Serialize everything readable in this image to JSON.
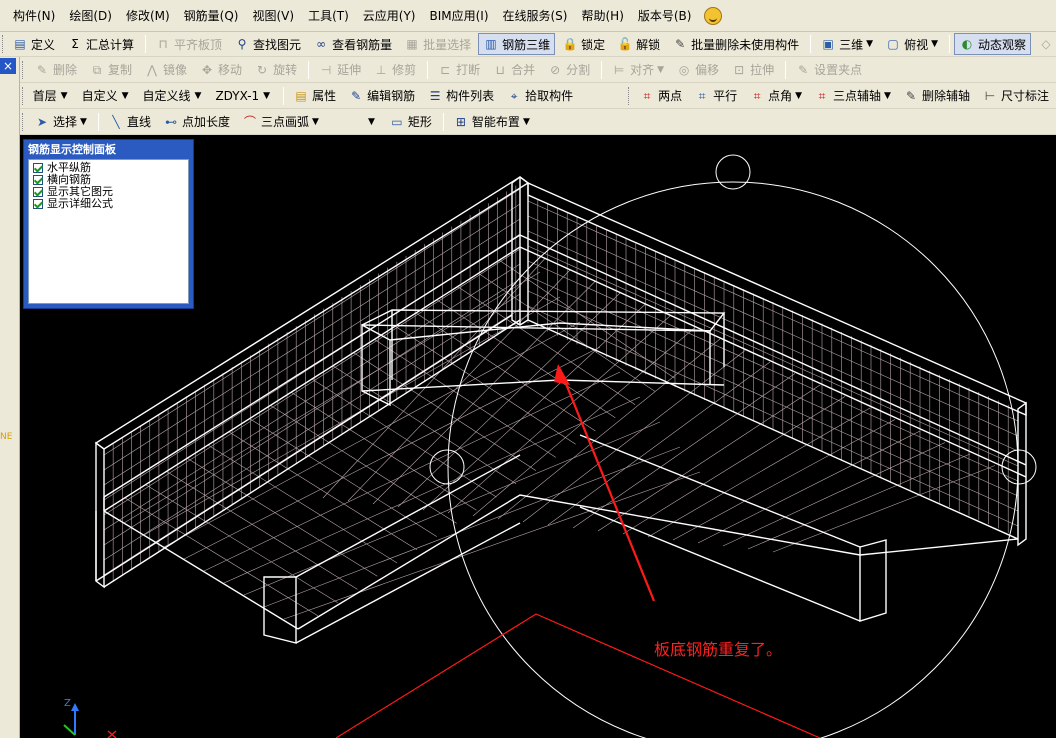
{
  "menu": {
    "items": [
      "构件(N)",
      "绘图(D)",
      "修改(M)",
      "钢筋量(Q)",
      "视图(V)",
      "工具(T)",
      "云应用(Y)",
      "BIM应用(I)",
      "在线服务(S)",
      "帮助(H)",
      "版本号(B)"
    ]
  },
  "toolbar1": {
    "items": [
      {
        "label": "定义",
        "icon": "define-icon",
        "glyph": "▤",
        "color": "#2a5ca8"
      },
      {
        "label": "汇总计算",
        "icon": "sigma-icon",
        "glyph": "Σ",
        "color": "#000000"
      },
      {
        "label": "平齐板顶",
        "icon": "align-top-icon",
        "glyph": "⊓",
        "color": "#a7a59a",
        "disabled": true
      },
      {
        "label": "查找图元",
        "icon": "binoculars-icon",
        "glyph": "⚲",
        "color": "#1b3f8a"
      },
      {
        "label": "查看钢筋量",
        "icon": "view-rebar-icon",
        "glyph": "∞",
        "color": "#1b3f8a"
      },
      {
        "label": "批量选择",
        "icon": "batch-select-icon",
        "glyph": "▦",
        "color": "#a7a59a",
        "disabled": true
      },
      {
        "label": "钢筋三维",
        "icon": "rebar-3d-icon",
        "glyph": "▥",
        "color": "#2a5ca8",
        "active": true
      },
      {
        "label": "锁定",
        "icon": "lock-icon",
        "glyph": "🔒",
        "color": "#c8951a"
      },
      {
        "label": "解锁",
        "icon": "unlock-icon",
        "glyph": "🔓",
        "color": "#c8951a"
      },
      {
        "label": "批量删除未使用构件",
        "icon": "batch-delete-icon",
        "glyph": "✎",
        "color": "#444444"
      },
      {
        "label": "三维",
        "icon": "cube-icon",
        "glyph": "▣",
        "color": "#2a5ca8",
        "dropdown": true
      },
      {
        "label": "俯视",
        "icon": "top-view-icon",
        "glyph": "▢",
        "color": "#2a5ca8",
        "dropdown": true
      },
      {
        "label": "动态观察",
        "icon": "orbit-icon",
        "glyph": "◐",
        "color": "#2f8a2f",
        "active": true
      },
      {
        "label": "局部三维",
        "icon": "partial-3d-icon",
        "glyph": "◇",
        "color": "#a7a59a",
        "disabled": true
      }
    ]
  },
  "toolbar2": {
    "items": [
      {
        "label": "删除",
        "icon": "delete-icon",
        "glyph": "✎"
      },
      {
        "label": "复制",
        "icon": "copy-icon",
        "glyph": "⧉"
      },
      {
        "label": "镜像",
        "icon": "mirror-icon",
        "glyph": "⋀"
      },
      {
        "label": "移动",
        "icon": "move-icon",
        "glyph": "✥"
      },
      {
        "label": "旋转",
        "icon": "rotate-icon",
        "glyph": "↻"
      },
      {
        "label": "延伸",
        "icon": "extend-icon",
        "glyph": "⊣"
      },
      {
        "label": "修剪",
        "icon": "trim-icon",
        "glyph": "⊥"
      },
      {
        "label": "打断",
        "icon": "break-icon",
        "glyph": "⊏"
      },
      {
        "label": "合并",
        "icon": "merge-icon",
        "glyph": "⊔"
      },
      {
        "label": "分割",
        "icon": "split-icon",
        "glyph": "⊘"
      },
      {
        "label": "对齐",
        "icon": "align-icon",
        "glyph": "⊨",
        "dropdown": true
      },
      {
        "label": "偏移",
        "icon": "offset-icon",
        "glyph": "◎"
      },
      {
        "label": "拉伸",
        "icon": "stretch-icon",
        "glyph": "⊡"
      },
      {
        "label": "设置夹点",
        "icon": "grip-point-icon",
        "glyph": "✎"
      }
    ]
  },
  "toolbar3": {
    "floor": "首层",
    "category": "自定义",
    "subtype": "自定义线",
    "component": "ZDYX-1",
    "buttons": [
      {
        "label": "属性",
        "icon": "properties-icon",
        "glyph": "▤",
        "color": "#c8951a"
      },
      {
        "label": "编辑钢筋",
        "icon": "edit-rebar-icon",
        "glyph": "✎",
        "color": "#1b3f8a"
      },
      {
        "label": "构件列表",
        "icon": "component-list-icon",
        "glyph": "☰",
        "color": "#1b3f8a"
      },
      {
        "label": "拾取构件",
        "icon": "pick-component-icon",
        "glyph": "⌖",
        "color": "#1b3f8a"
      }
    ],
    "right_buttons": [
      {
        "label": "两点",
        "icon": "two-point-icon",
        "glyph": "⌗",
        "color": "#c62020"
      },
      {
        "label": "平行",
        "icon": "parallel-icon",
        "glyph": "⌗",
        "color": "#2a5ca8"
      },
      {
        "label": "点角",
        "icon": "point-angle-icon",
        "glyph": "⌗",
        "color": "#c62020",
        "dropdown": true
      },
      {
        "label": "三点辅轴",
        "icon": "three-point-axis-icon",
        "glyph": "⌗",
        "color": "#c62020",
        "dropdown": true
      },
      {
        "label": "删除辅轴",
        "icon": "delete-axis-icon",
        "glyph": "✎",
        "color": "#444444"
      },
      {
        "label": "尺寸标注",
        "icon": "dimension-icon",
        "glyph": "⊢",
        "color": "#444444"
      }
    ]
  },
  "toolbar4": {
    "select_label": "选择",
    "items": [
      {
        "label": "直线",
        "icon": "line-icon",
        "glyph": "╲",
        "color": "#2a5ca8"
      },
      {
        "label": "点加长度",
        "icon": "point-length-icon",
        "glyph": "⊷",
        "color": "#2a5ca8"
      },
      {
        "label": "三点画弧",
        "icon": "arc-icon",
        "glyph": "⌒",
        "color": "#c62020",
        "dropdown": true
      }
    ],
    "rect_label": "矩形",
    "smart_label": "智能布置"
  },
  "panel": {
    "title": "钢筋显示控制面板",
    "options": [
      {
        "label": "水平纵筋",
        "checked": true
      },
      {
        "label": "横向钢筋",
        "checked": true
      },
      {
        "label": "显示其它图元",
        "checked": true
      },
      {
        "label": "显示详细公式",
        "checked": true
      }
    ]
  },
  "annotation": {
    "text": "板底钢筋重复了。",
    "color": "#ff2020"
  },
  "axis": {
    "z_label": "Z"
  },
  "side": {
    "ne_label": "NE",
    "close_glyph": "×"
  },
  "colors": {
    "chrome": "#ece9d8",
    "panel_title": "#2b5bc0",
    "viewport": "#000000",
    "wire": "#ffffff",
    "mesh": "#b9a6a6"
  }
}
